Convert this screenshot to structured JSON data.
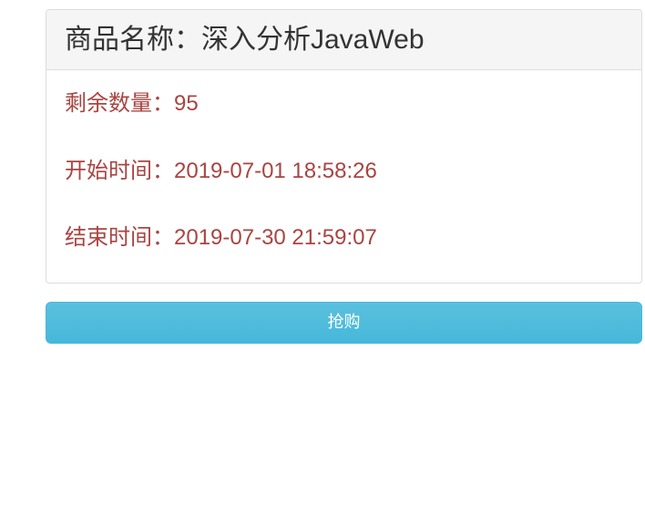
{
  "product": {
    "title_label": "商品名称：",
    "title_value": "深入分析JavaWeb",
    "remaining_label": "剩余数量：",
    "remaining_value": "95",
    "start_label": "开始时间：",
    "start_value": "2019-07-01 18:58:26",
    "end_label": "结束时间：",
    "end_value": "2019-07-30 21:59:07"
  },
  "actions": {
    "buy_label": "抢购"
  }
}
